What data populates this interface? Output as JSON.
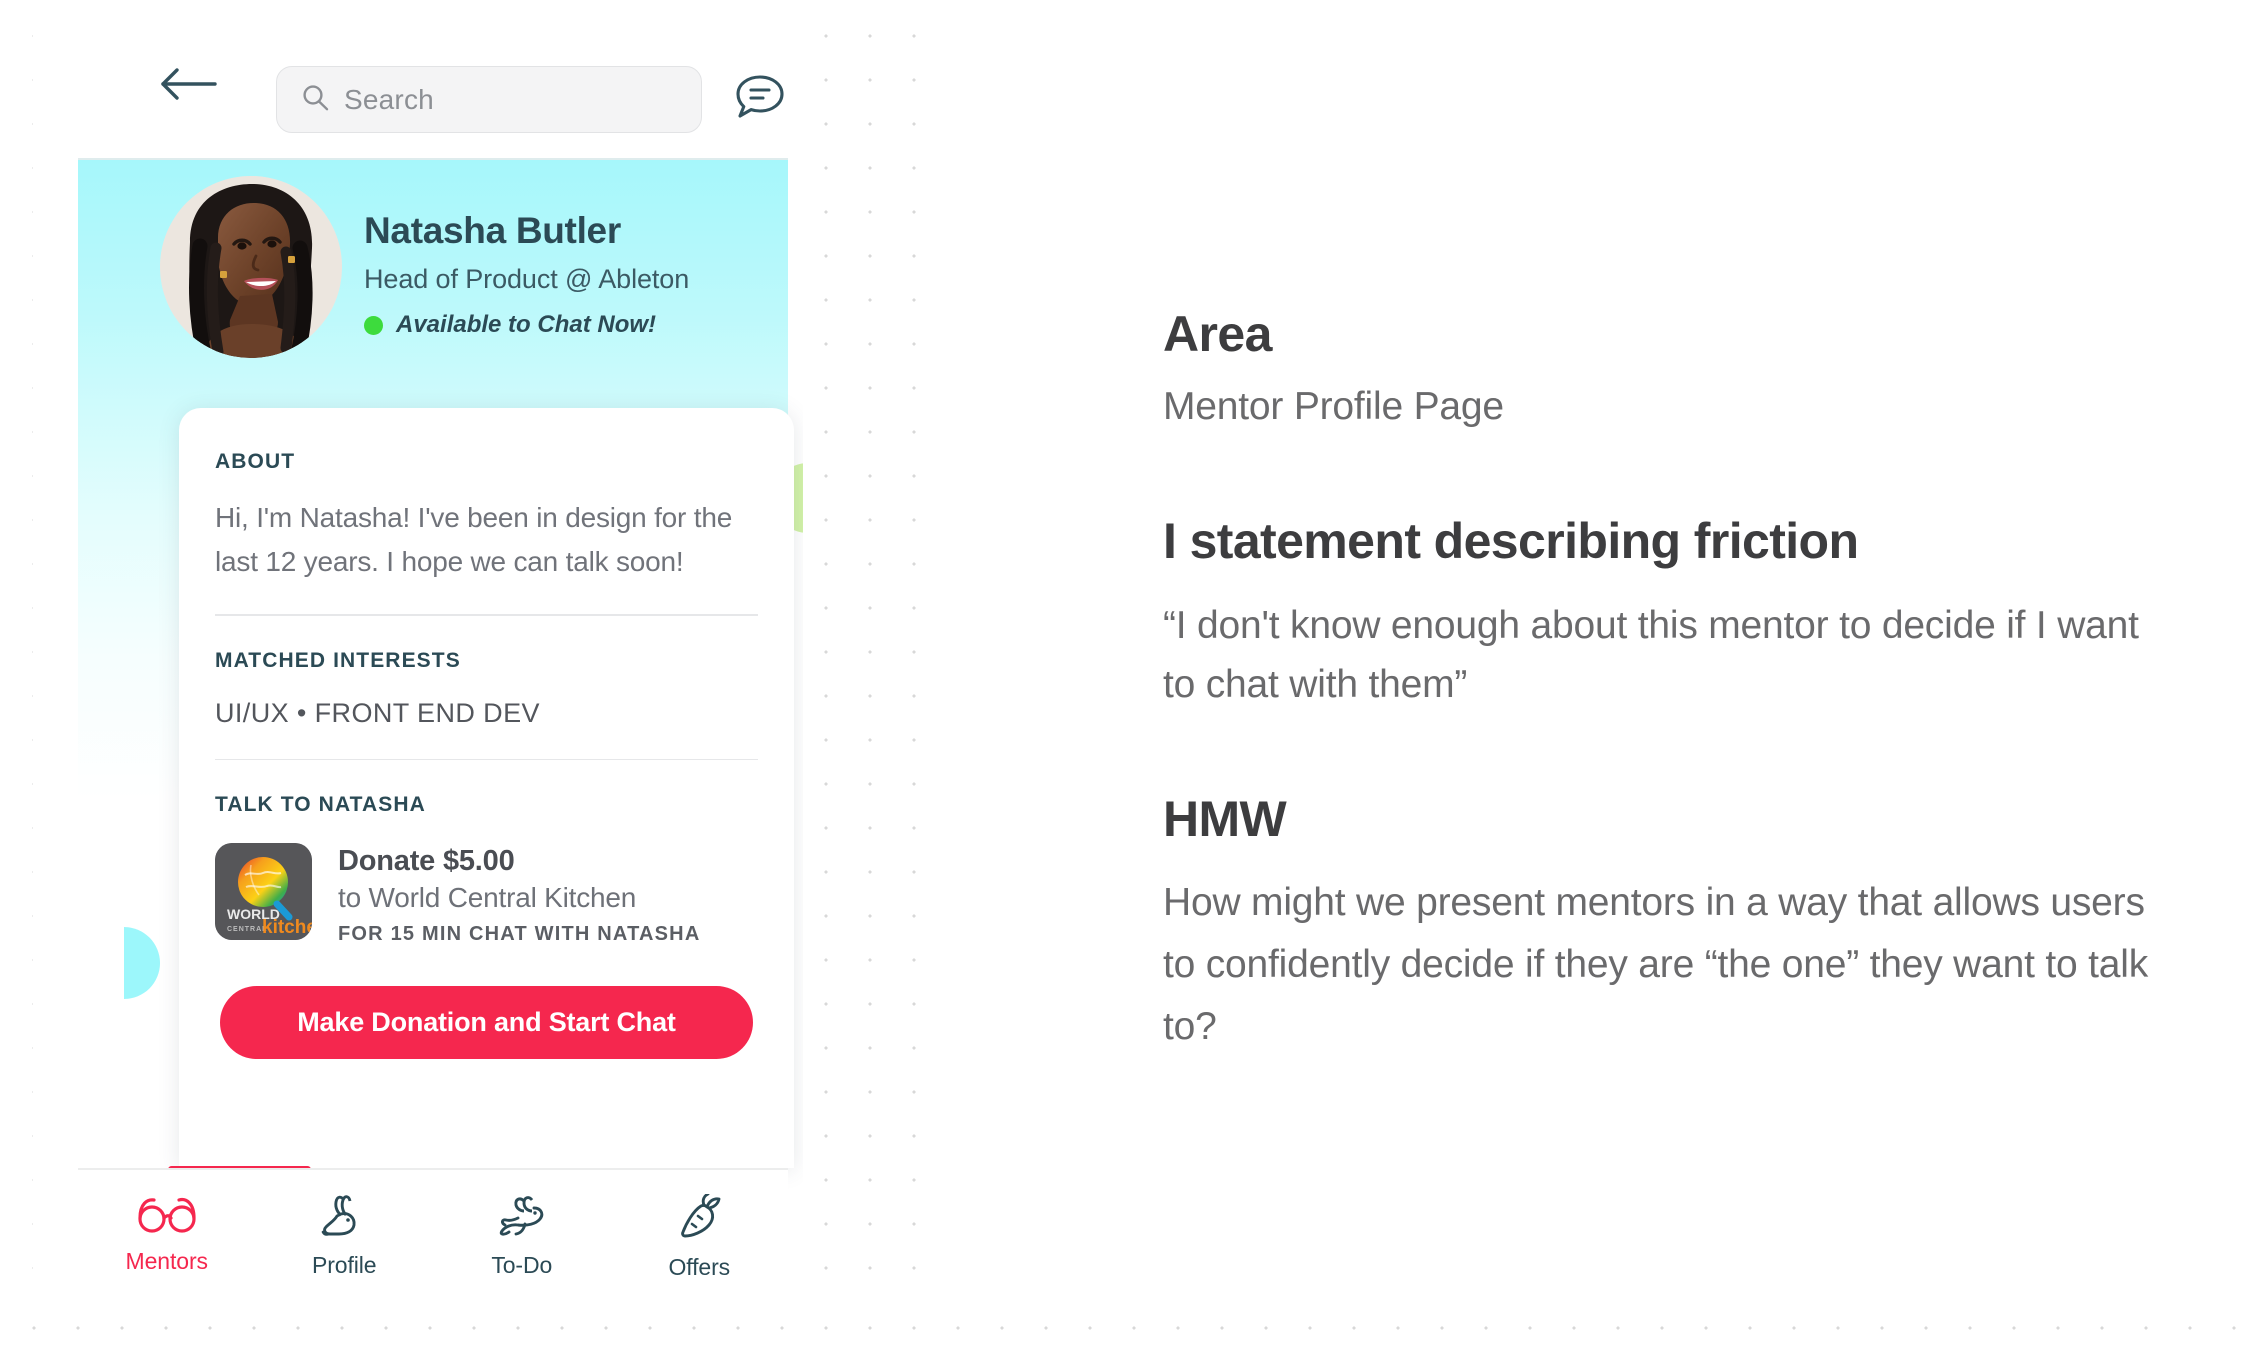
{
  "app": {
    "topbar": {
      "back_icon": "back-arrow-icon",
      "chat_icon": "chat-bubble-icon",
      "search_placeholder": "Search",
      "search_value": "",
      "search_icon": "search-icon"
    },
    "profile": {
      "name": "Natasha Butler",
      "role": "Head of Product @ Ableton",
      "availability": "Available to Chat Now!",
      "availability_dot_color": "#3ddb3d",
      "avatar_alt": "Natasha Butler profile photo"
    },
    "card": {
      "about_label": "ABOUT",
      "about_text": "Hi, I'm Natasha! I've been in design for the last 12 years. I hope we can talk soon!",
      "matched_interests_label": "MATCHED INTERESTS",
      "matched_interests_value": "UI/UX • FRONT END DEV",
      "talk_label": "TALK TO NATASHA",
      "donation": {
        "logo_name": "world-central-kitchen-logo",
        "logo_text_top": "WORLD",
        "logo_text_mid": "CENTRAL",
        "logo_text_bottom": "kitchen",
        "amount": "Donate $5.00",
        "organization": "to World Central Kitchen",
        "note": "FOR 15 MIN CHAT WITH NATASHA"
      },
      "cta_label": "Make Donation and Start Chat"
    },
    "nav": {
      "active_index": 0,
      "items": [
        {
          "label": "Mentors",
          "icon": "glasses-icon"
        },
        {
          "label": "Profile",
          "icon": "rabbit-sitting-icon"
        },
        {
          "label": "To-Do",
          "icon": "rabbit-hopping-icon"
        },
        {
          "label": "Offers",
          "icon": "carrot-icon"
        }
      ]
    },
    "colors": {
      "accent_red": "#f5274e",
      "hero_cyan": "#a6f7fb",
      "heading_navy": "#2b4a55",
      "blob_cyan": "#9cf7fb",
      "blob_green": "#d2f2a8"
    }
  },
  "annotations": {
    "area_heading": "Area",
    "area_body": "Mentor Profile Page",
    "friction_heading": "I statement describing friction",
    "friction_body": "“I don't know enough about this mentor to decide if I want to chat with them”",
    "hmw_heading": "HMW",
    "hmw_body": "How might we present mentors in a way that allows users to confidently decide if they are “the one” they want to talk to?"
  }
}
